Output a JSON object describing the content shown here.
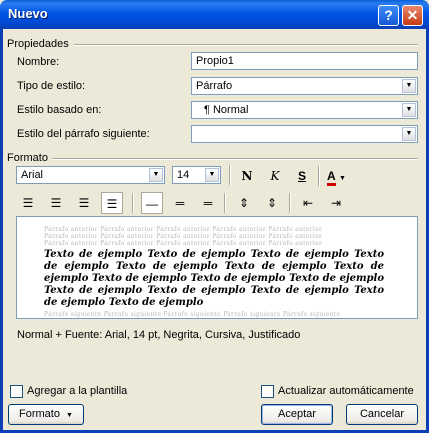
{
  "window": {
    "title": "Nuevo",
    "help_glyph": "?",
    "close_glyph": "✕"
  },
  "properties": {
    "group_label": "Propiedades",
    "name_label": "Nombre:",
    "name_value": "Propio1",
    "style_type_label": "Tipo de estilo:",
    "style_type_value": "Párrafo",
    "based_on_label": "Estilo basado en:",
    "based_on_value": "¶ Normal",
    "next_style_label": "Estilo del párrafo siguiente:",
    "next_style_value": ""
  },
  "format": {
    "group_label": "Formato",
    "font_value": "Arial",
    "size_value": "14",
    "bold_glyph": "N",
    "italic_glyph": "K",
    "underline_glyph": "S",
    "font_color_glyph": "A",
    "font_color": "#cc0000"
  },
  "preview": {
    "ghost_before": "Párrafo anterior Párrafo anterior Párrafo anterior Párrafo anterior Párrafo anterior",
    "sample_text": "Texto de ejemplo Texto de ejemplo Texto de ejemplo Texto de ejemplo Texto de ejemplo Texto de ejemplo Texto de ejemplo Texto de ejemplo Texto de ejemplo Texto de ejemplo Texto de ejemplo Texto de ejemplo Texto de ejemplo Texto de ejemplo Texto de ejemplo",
    "ghost_after": "Párrafo siguiente Párrafo siguiente Párrafo siguiente Párrafo siguiente Párrafo siguiente"
  },
  "description": "Normal + Fuente: Arial, 14 pt, Negrita, Cursiva, Justificado",
  "options": {
    "add_template_label": "Agregar a la plantilla",
    "add_template_checked": false,
    "auto_update_label": "Actualizar automáticamente",
    "auto_update_checked": false
  },
  "buttons": {
    "format_label": "Formato",
    "accept_label": "Aceptar",
    "cancel_label": "Cancelar"
  }
}
